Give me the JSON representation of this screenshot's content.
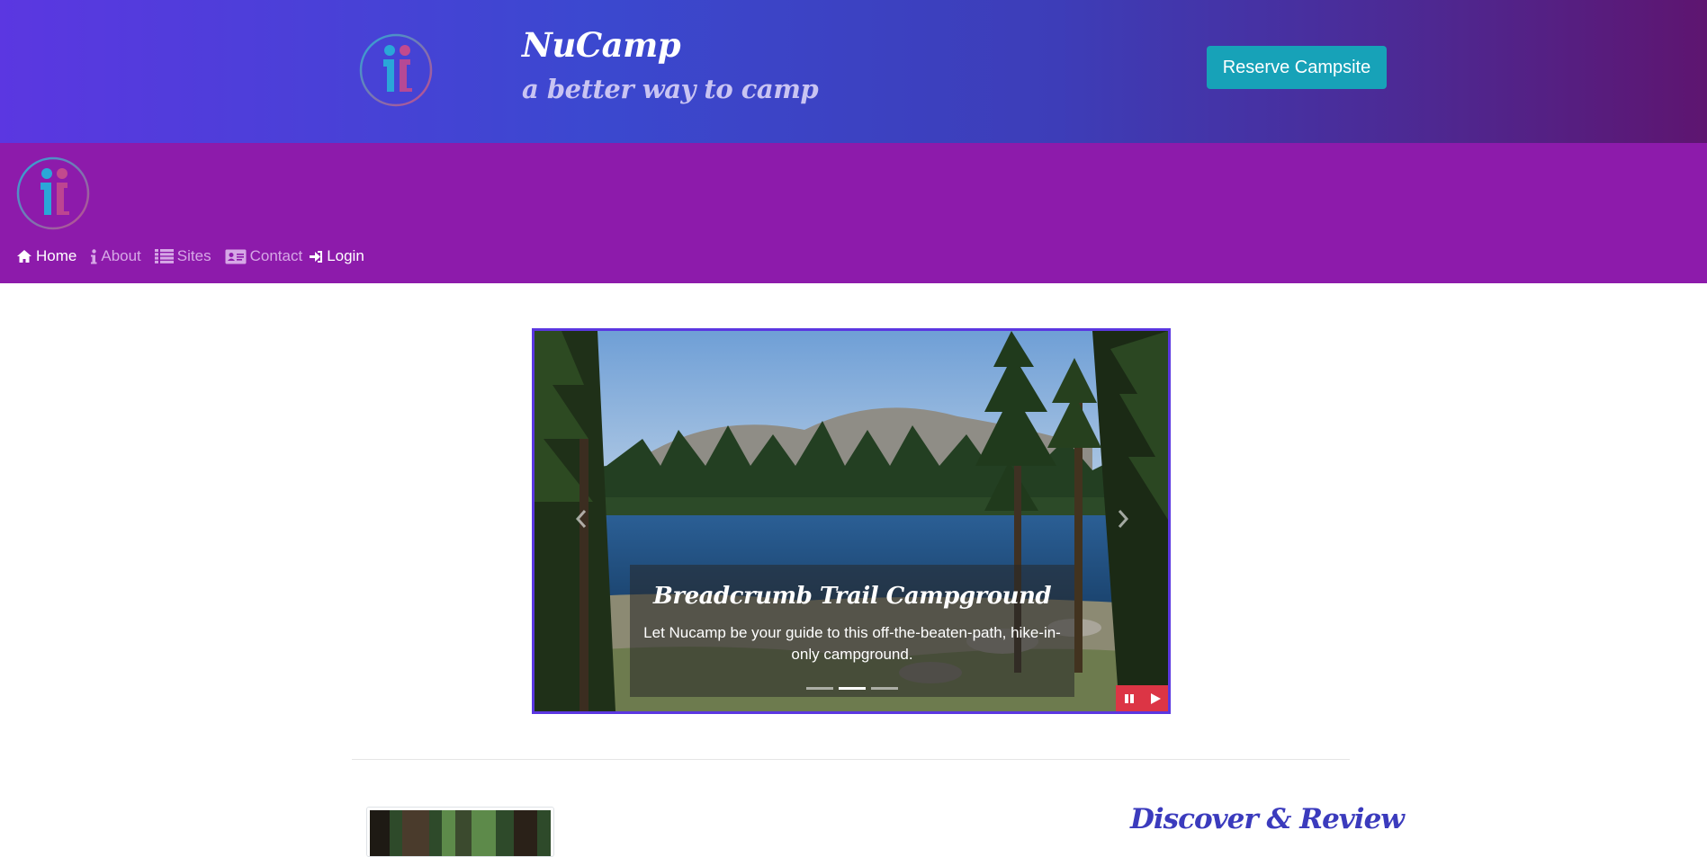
{
  "header": {
    "brand_title": "NuCamp",
    "brand_subtitle": "a better way to camp",
    "reserve_label": "Reserve Campsite",
    "logo_icon": "nucamp-logo-icon"
  },
  "nav": {
    "items": [
      {
        "label": "Home",
        "icon": "home-icon",
        "active": true
      },
      {
        "label": "About",
        "icon": "info-icon",
        "active": false
      },
      {
        "label": "Sites",
        "icon": "list-icon",
        "active": false
      },
      {
        "label": "Contact",
        "icon": "address-card-icon",
        "active": false
      }
    ],
    "login_label": "Login"
  },
  "carousel": {
    "caption_title": "Breadcrumb Trail Campground",
    "caption_text": "Let Nucamp be your guide to this off-the-beaten-path, hike-in-only campground.",
    "slide_count": 3,
    "active_slide": 2
  },
  "section": {
    "title": "Discover & Review"
  },
  "colors": {
    "header_gradient_start": "#5b37e1",
    "header_gradient_end": "#5e1570",
    "navbar": "#8d1bab",
    "reserve_button": "#17a2b8",
    "carousel_border": "#5b37e1",
    "play_controls": "#dc3545",
    "section_title": "#3b3bbd"
  }
}
